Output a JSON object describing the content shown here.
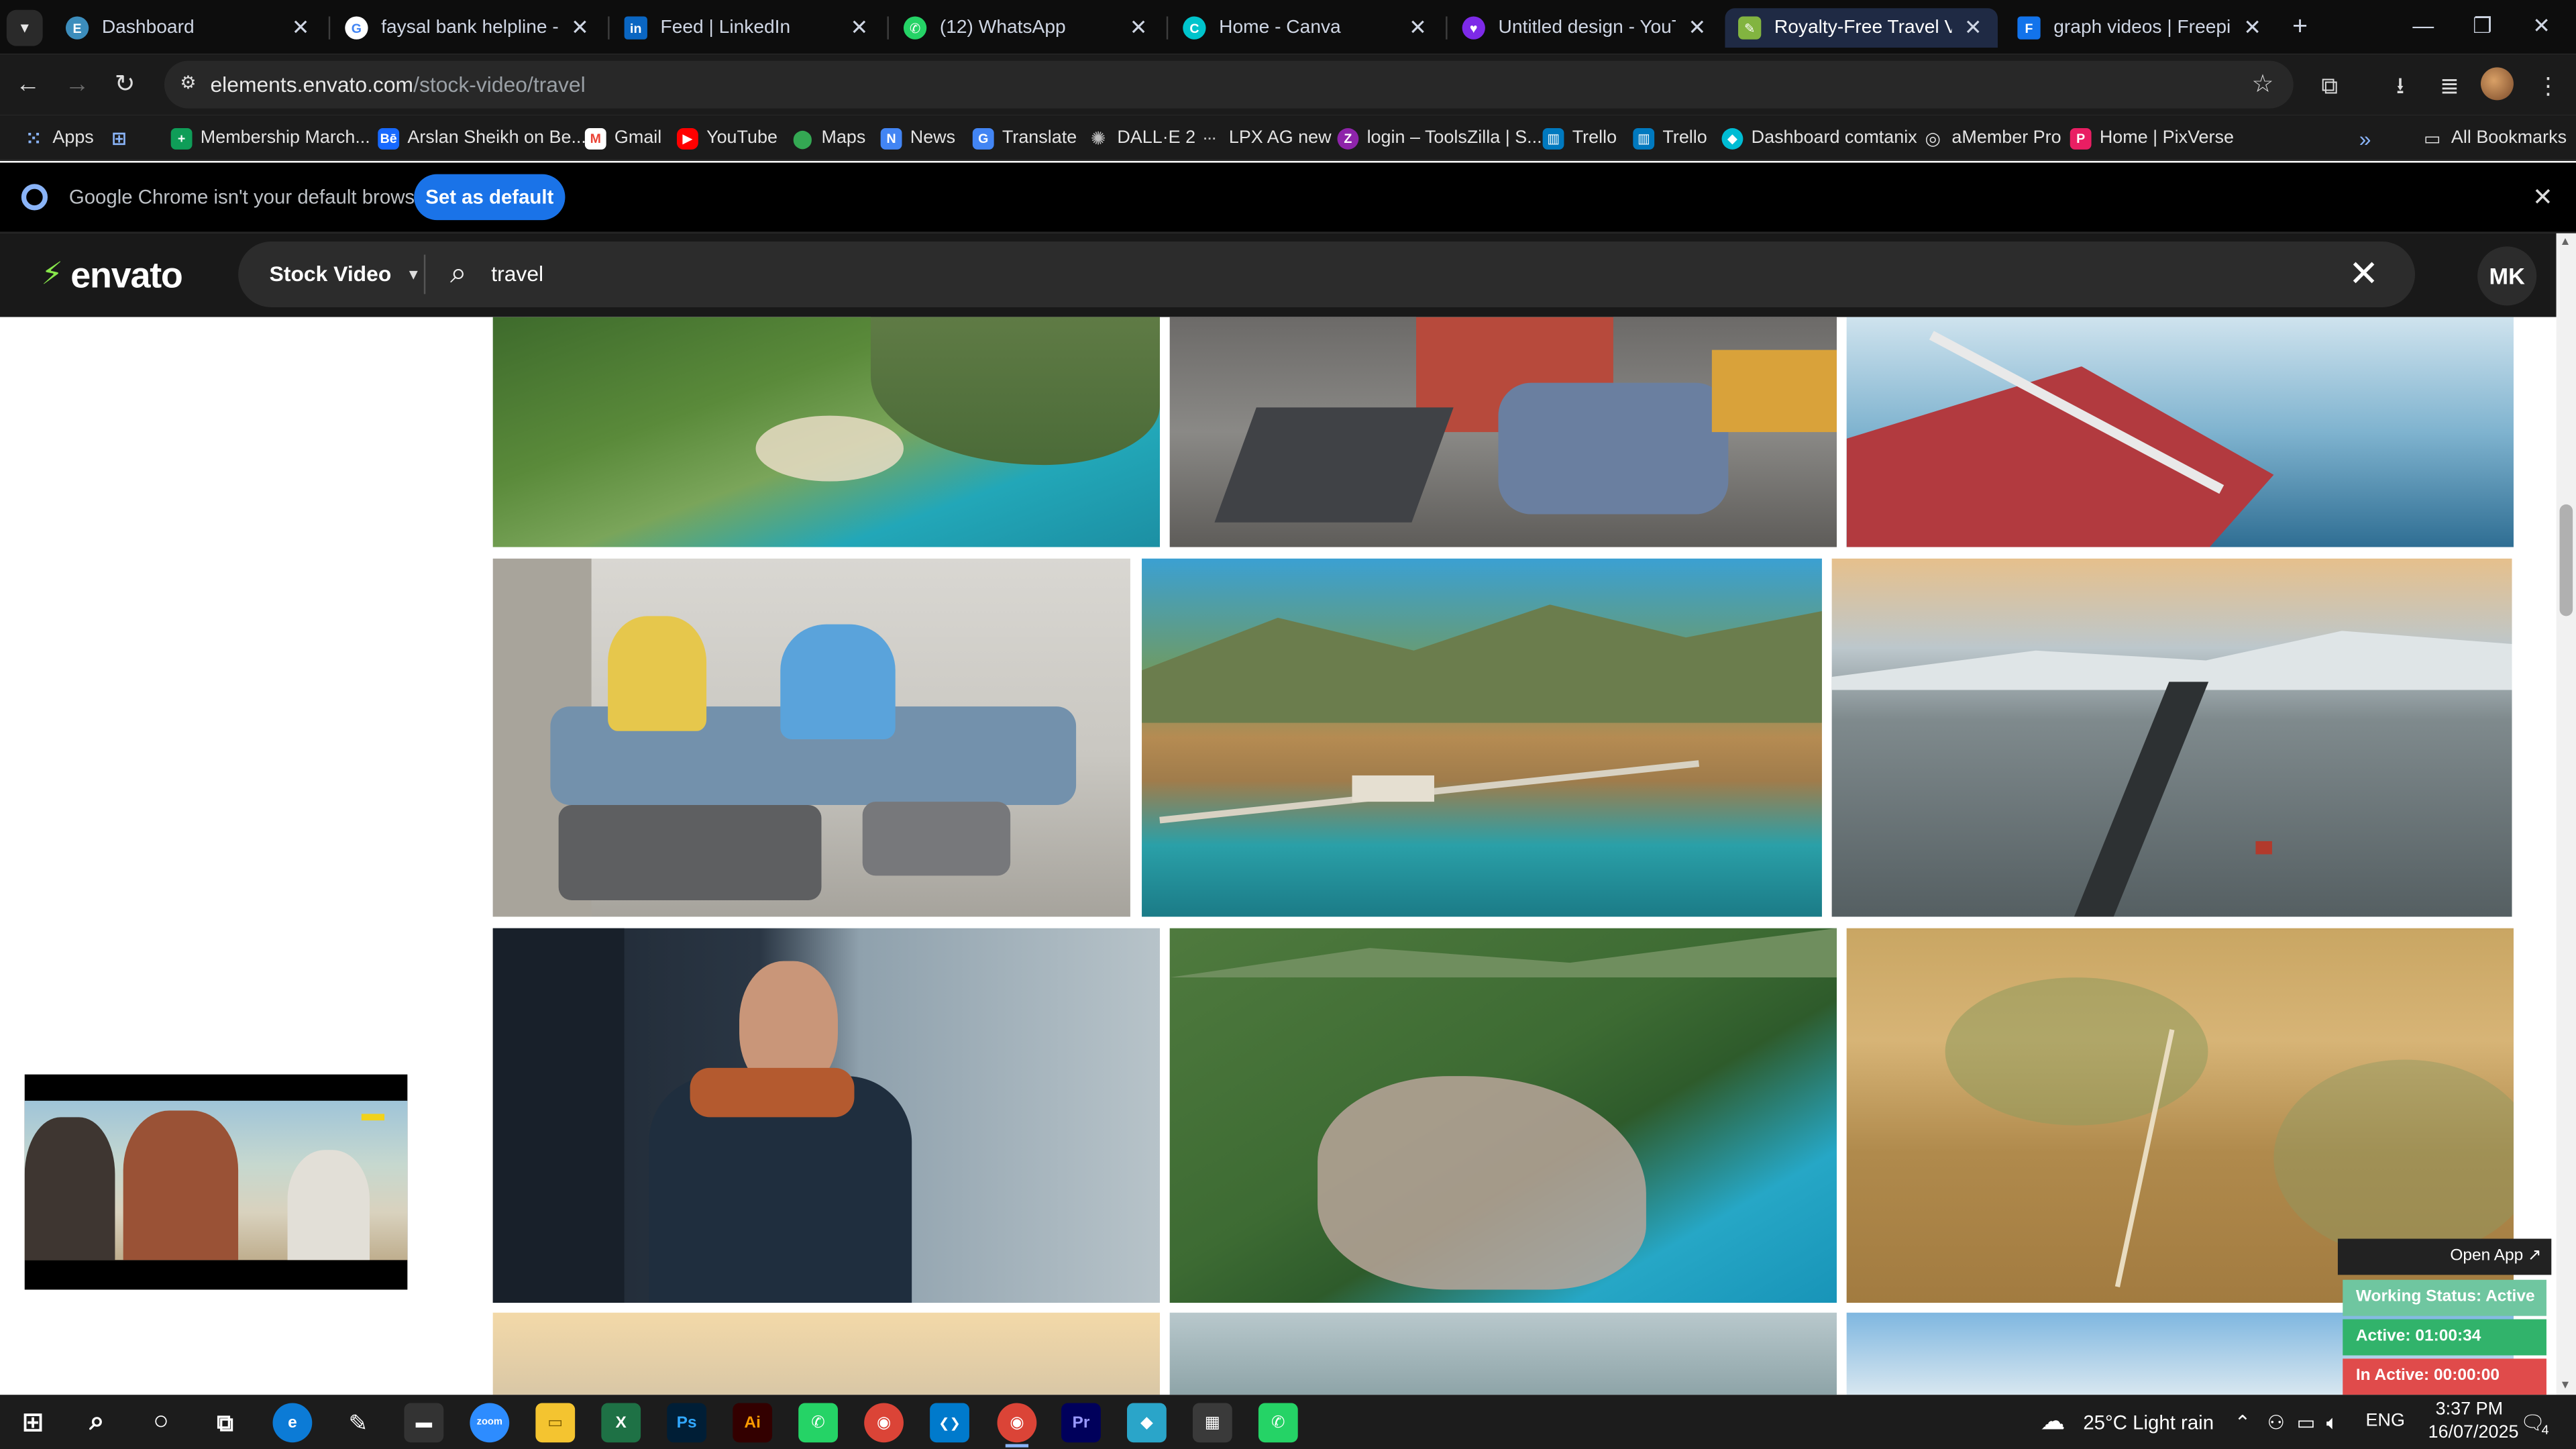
{
  "browser": {
    "tabs": [
      {
        "title": "Dashboard",
        "favicon": "envato-dashboard-icon",
        "color": "#3c8dbc",
        "active": false
      },
      {
        "title": "faysal bank helpline - Google",
        "favicon": "google-icon",
        "color": "#4285f4",
        "active": false
      },
      {
        "title": "Feed | LinkedIn",
        "favicon": "linkedin-icon",
        "color": "#0a66c2",
        "active": false
      },
      {
        "title": "(12) WhatsApp",
        "favicon": "whatsapp-icon",
        "color": "#25d366",
        "active": false
      },
      {
        "title": "Home - Canva",
        "favicon": "canva-icon",
        "color": "#00c4cc",
        "active": false
      },
      {
        "title": "Untitled design - YouTube",
        "favicon": "canva-heart-icon",
        "color": "#7d2ae8",
        "active": false
      },
      {
        "title": "Royalty-Free Travel Videos",
        "favicon": "envato-leaf-icon",
        "color": "#82b440",
        "active": true
      },
      {
        "title": "graph videos | Freepik",
        "favicon": "freepik-icon",
        "color": "#1273eb",
        "active": false
      }
    ],
    "url_host": "elements.envato.com",
    "url_path": "/stock-video/travel",
    "bookmarks": [
      {
        "label": "Apps",
        "icon": "apps-grid-icon",
        "color": "#5f6368"
      },
      {
        "label": "",
        "icon": "grid-icon",
        "color": "#3b3b3b"
      },
      {
        "label": "Membership March...",
        "icon": "sheets-icon",
        "color": "#0f9d58"
      },
      {
        "label": "Arslan Sheikh on Be...",
        "icon": "behance-icon",
        "color": "#1769ff"
      },
      {
        "label": "Gmail",
        "icon": "gmail-icon",
        "color": "#ea4335"
      },
      {
        "label": "YouTube",
        "icon": "youtube-icon",
        "color": "#ff0000"
      },
      {
        "label": "Maps",
        "icon": "maps-icon",
        "color": "#34a853"
      },
      {
        "label": "News",
        "icon": "news-icon",
        "color": "#4285f4"
      },
      {
        "label": "Translate",
        "icon": "translate-icon",
        "color": "#4285f4"
      },
      {
        "label": "DALL·E 2",
        "icon": "openai-icon",
        "color": "#202123"
      },
      {
        "label": "LPX AG new",
        "icon": "dots-icon",
        "color": "#444444"
      },
      {
        "label": "login – ToolsZilla | S...",
        "icon": "toolszilla-icon",
        "color": "#8e24aa"
      },
      {
        "label": "Trello",
        "icon": "trello-icon",
        "color": "#0079bf"
      },
      {
        "label": "Trello",
        "icon": "trello-icon",
        "color": "#0079bf"
      },
      {
        "label": "Dashboard comtanix",
        "icon": "comtanix-icon",
        "color": "#00bcd4"
      },
      {
        "label": "aMember Pro",
        "icon": "amember-icon",
        "color": "#607d8b"
      },
      {
        "label": "Home | PixVerse",
        "icon": "pixverse-icon",
        "color": "#e91e63"
      }
    ],
    "all_bookmarks": "All Bookmarks",
    "infobar_message": "Google Chrome isn't your default browser",
    "infobar_button": "Set as default"
  },
  "envato": {
    "logo": "envato",
    "category": "Stock Video",
    "query": "travel",
    "avatar_initials": "MK"
  },
  "widget": {
    "open_app": "Open App ↗",
    "working_status": "Working Status: Active",
    "active": "Active: 01:00:34",
    "inactive": "In Active: 00:00:00",
    "colors": {
      "working": "#6fc6a0",
      "active": "#31b36b",
      "inactive": "#e04b4b"
    }
  },
  "taskbar": {
    "apps": [
      {
        "name": "windows-start-icon",
        "label": "⊞",
        "color": "#1c1c1c"
      },
      {
        "name": "search-icon",
        "label": "⌕",
        "color": "#1c1c1c"
      },
      {
        "name": "cortana-icon",
        "label": "○",
        "color": "#1c1c1c"
      },
      {
        "name": "task-view-icon",
        "label": "⧉",
        "color": "#1c1c1c"
      },
      {
        "name": "edge-icon",
        "label": "e",
        "color": "#0c7bd6"
      },
      {
        "name": "pen-icon",
        "label": "✎",
        "color": "#1c1c1c"
      },
      {
        "name": "terminal-icon",
        "label": "▬",
        "color": "#333333"
      },
      {
        "name": "zoom-icon",
        "label": "zoom",
        "color": "#2d8cff"
      },
      {
        "name": "file-explorer-icon",
        "label": "▭",
        "color": "#f4c430"
      },
      {
        "name": "excel-icon",
        "label": "X",
        "color": "#1e7145"
      },
      {
        "name": "photoshop-icon",
        "label": "Ps",
        "color": "#001e36"
      },
      {
        "name": "illustrator-icon",
        "label": "Ai",
        "color": "#330000"
      },
      {
        "name": "whatsapp-desktop-icon",
        "label": "✆",
        "color": "#25d366"
      },
      {
        "name": "chrome-icon",
        "label": "◉",
        "color": "#db4437"
      },
      {
        "name": "vscode-icon",
        "label": "❮❯",
        "color": "#007acc"
      },
      {
        "name": "chrome-profile-icon",
        "label": "◉",
        "color": "#db4437"
      },
      {
        "name": "premiere-icon",
        "label": "Pr",
        "color": "#00005b"
      },
      {
        "name": "app-diamond-icon",
        "label": "◆",
        "color": "#2aa5c9"
      },
      {
        "name": "calculator-icon",
        "label": "▦",
        "color": "#3a3a3a"
      },
      {
        "name": "whatsapp-business-icon",
        "label": "✆",
        "color": "#25d366"
      }
    ],
    "weather": "25°C  Light rain",
    "language": "ENG",
    "time": "3:37 PM",
    "date": "16/07/2025",
    "notifications": "4"
  }
}
